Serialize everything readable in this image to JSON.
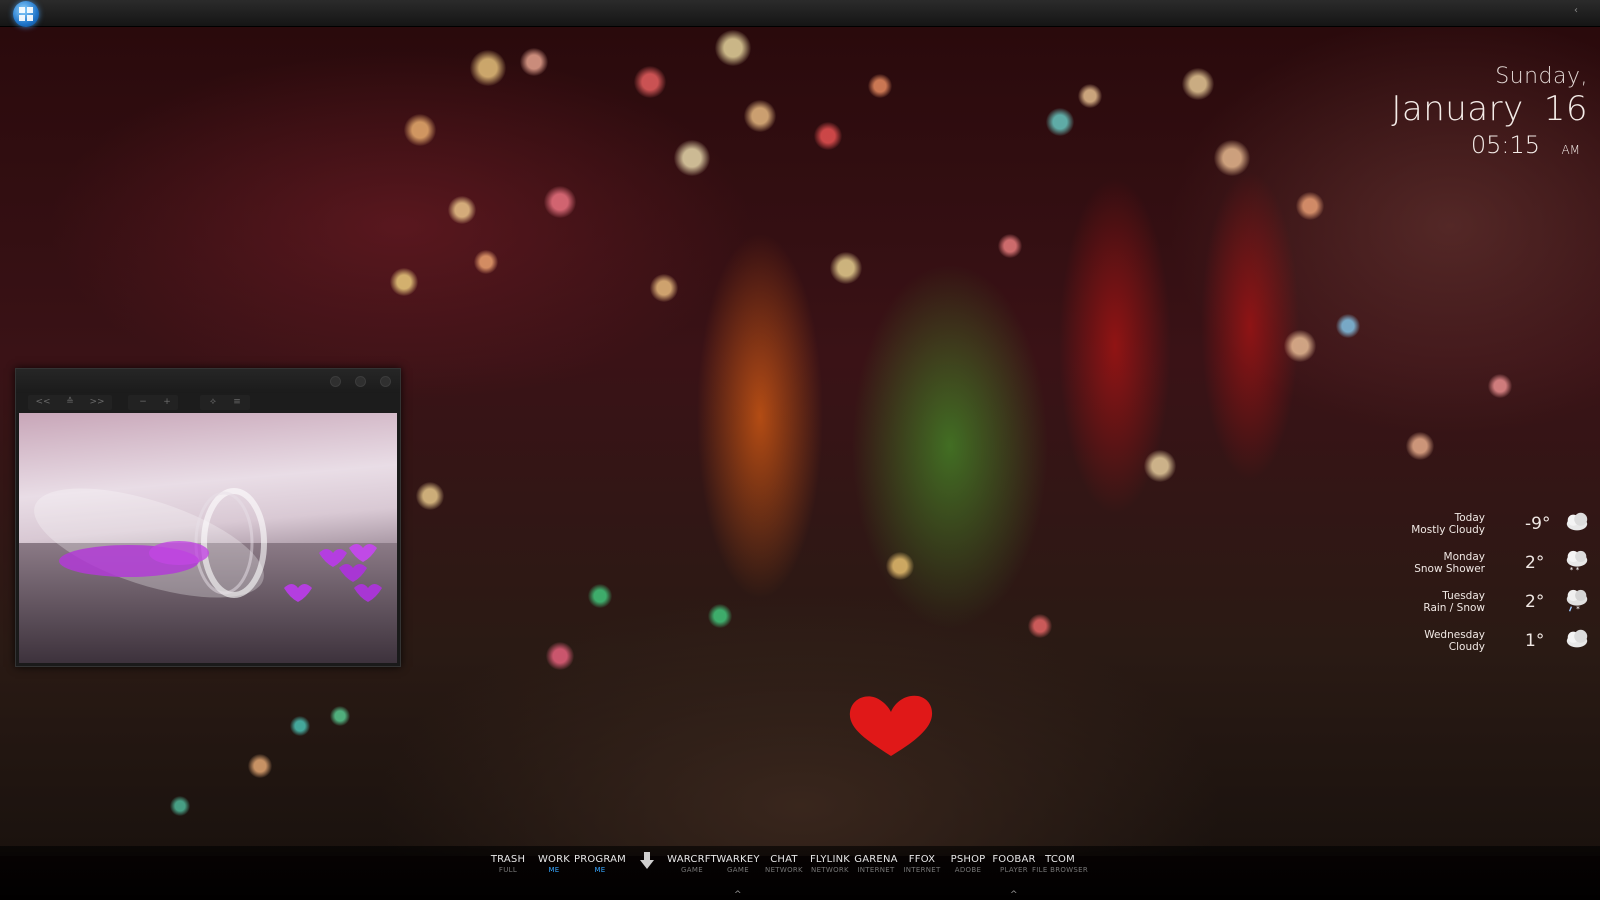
{
  "clock": {
    "day": "Sunday,",
    "month": "January",
    "date": "16",
    "time": "05:15",
    "ampm": "AM"
  },
  "weather": [
    {
      "day": "Today",
      "condition": "Mostly Cloudy",
      "temp": "-9°",
      "icon": "cloud-icon"
    },
    {
      "day": "Monday",
      "condition": "Snow Shower",
      "temp": "2°",
      "icon": "snow-cloud-icon"
    },
    {
      "day": "Tuesday",
      "condition": "Rain / Snow",
      "temp": "2°",
      "icon": "rain-snow-cloud-icon"
    },
    {
      "day": "Wednesday",
      "condition": "Cloudy",
      "temp": "1°",
      "icon": "cloud-icon"
    }
  ],
  "viewer": {
    "toolbar": [
      "<<",
      "≙",
      ">>",
      "−",
      "+",
      "⟡",
      "≡"
    ]
  },
  "dock": [
    {
      "label": "TRASH",
      "sub": "FULL"
    },
    {
      "label": "WORK",
      "sub": "ME"
    },
    {
      "label": "PROGRAM",
      "sub": "ME"
    },
    {
      "label": "",
      "sub": "",
      "icon": "download-arrow-icon"
    },
    {
      "label": "WARCRFT",
      "sub": "GAME"
    },
    {
      "label": "WARKEY",
      "sub": "GAME"
    },
    {
      "label": "CHAT",
      "sub": "NETWORK"
    },
    {
      "label": "FLYLINK",
      "sub": "NETWORK"
    },
    {
      "label": "GARENA",
      "sub": "INTERNET"
    },
    {
      "label": "FFOX",
      "sub": "INTERNET"
    },
    {
      "label": "PSHOP",
      "sub": "ADOBE"
    },
    {
      "label": "FOOBAR",
      "sub": "PLAYER"
    },
    {
      "label": "TCOM",
      "sub": "FILE BROWSER"
    }
  ],
  "colors": {
    "accent": "#36a6ff",
    "text": "#f0e8e4"
  }
}
